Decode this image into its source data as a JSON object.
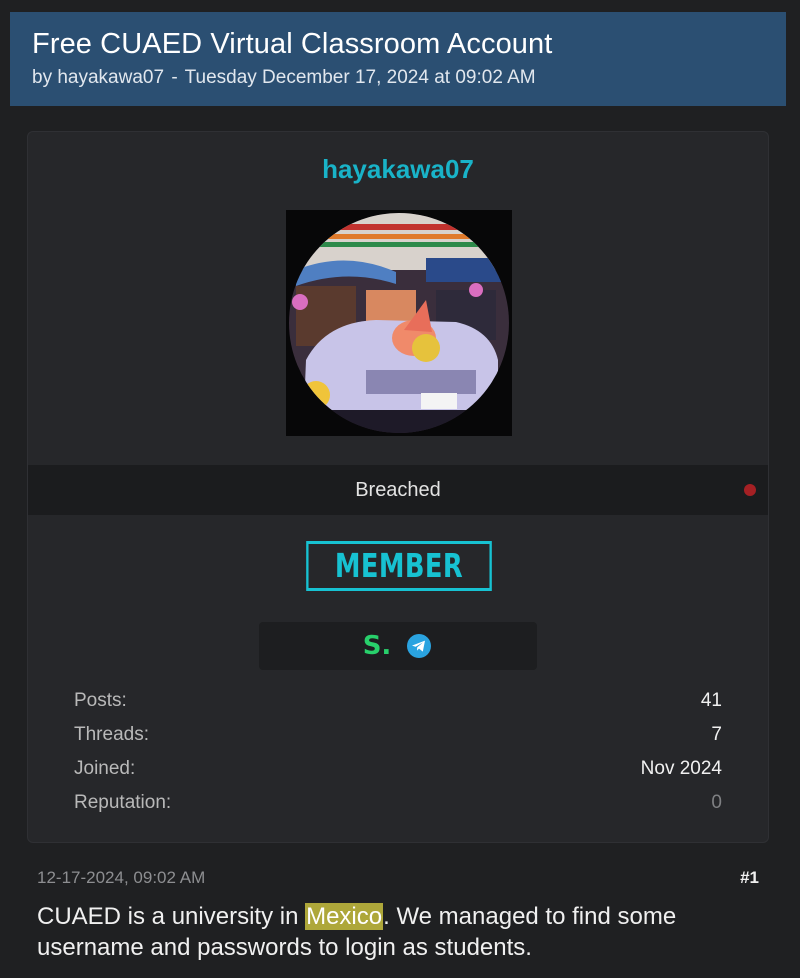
{
  "thread": {
    "title": "Free CUAED Virtual Classroom Account",
    "byline_prefix": "by",
    "author": "hayakawa07",
    "byline_separator": "-",
    "posted_on": "Tuesday December 17, 2024 at 09:02 AM"
  },
  "user_card": {
    "username": "hayakawa07",
    "rank_title": "Breached",
    "group_badge": "MEMBER",
    "contacts": [
      {
        "icon": "session-icon",
        "glyph": "S."
      },
      {
        "icon": "telegram-icon"
      }
    ],
    "stats": {
      "posts_label": "Posts:",
      "posts_value": "41",
      "threads_label": "Threads:",
      "threads_value": "7",
      "joined_label": "Joined:",
      "joined_value": "Nov 2024",
      "reputation_label": "Reputation:",
      "reputation_value": "0"
    }
  },
  "post": {
    "date": "12-17-2024, 09:02 AM",
    "number": "#1",
    "body_before": "CUAED is a university in ",
    "body_highlight": "Mexico",
    "body_after": ". We managed to find some username and passwords to login as students."
  },
  "colors": {
    "header_bg": "#2b4f72",
    "username": "#19b3c8",
    "member_badge": "#17c2d2",
    "status_dot": "#a52024",
    "highlight": "#aea73a"
  }
}
